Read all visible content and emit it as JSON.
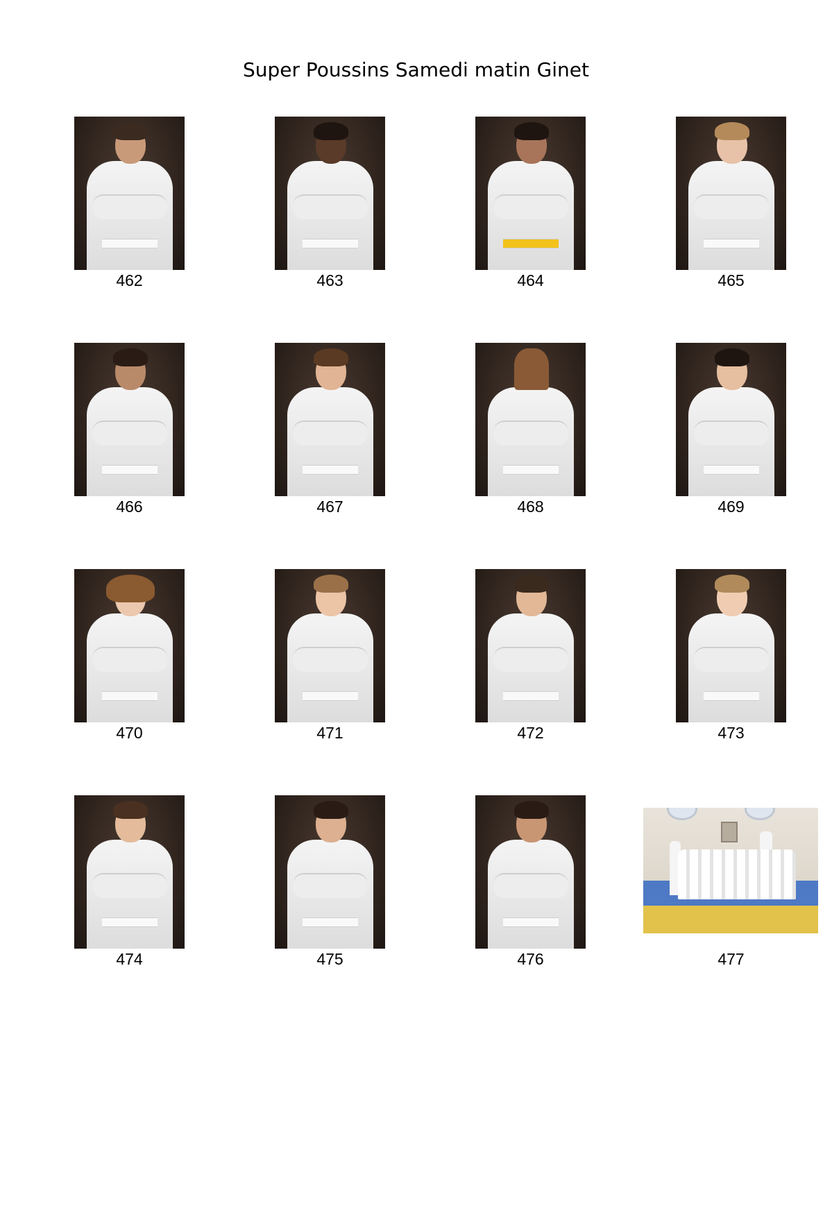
{
  "page": {
    "title": "Super Poussins Samedi matin Ginet"
  },
  "photos": [
    {
      "number": "462"
    },
    {
      "number": "463"
    },
    {
      "number": "464"
    },
    {
      "number": "465"
    },
    {
      "number": "466"
    },
    {
      "number": "467"
    },
    {
      "number": "468"
    },
    {
      "number": "469"
    },
    {
      "number": "470"
    },
    {
      "number": "471"
    },
    {
      "number": "472"
    },
    {
      "number": "473"
    },
    {
      "number": "474"
    },
    {
      "number": "475"
    },
    {
      "number": "476"
    },
    {
      "number": "477"
    }
  ]
}
